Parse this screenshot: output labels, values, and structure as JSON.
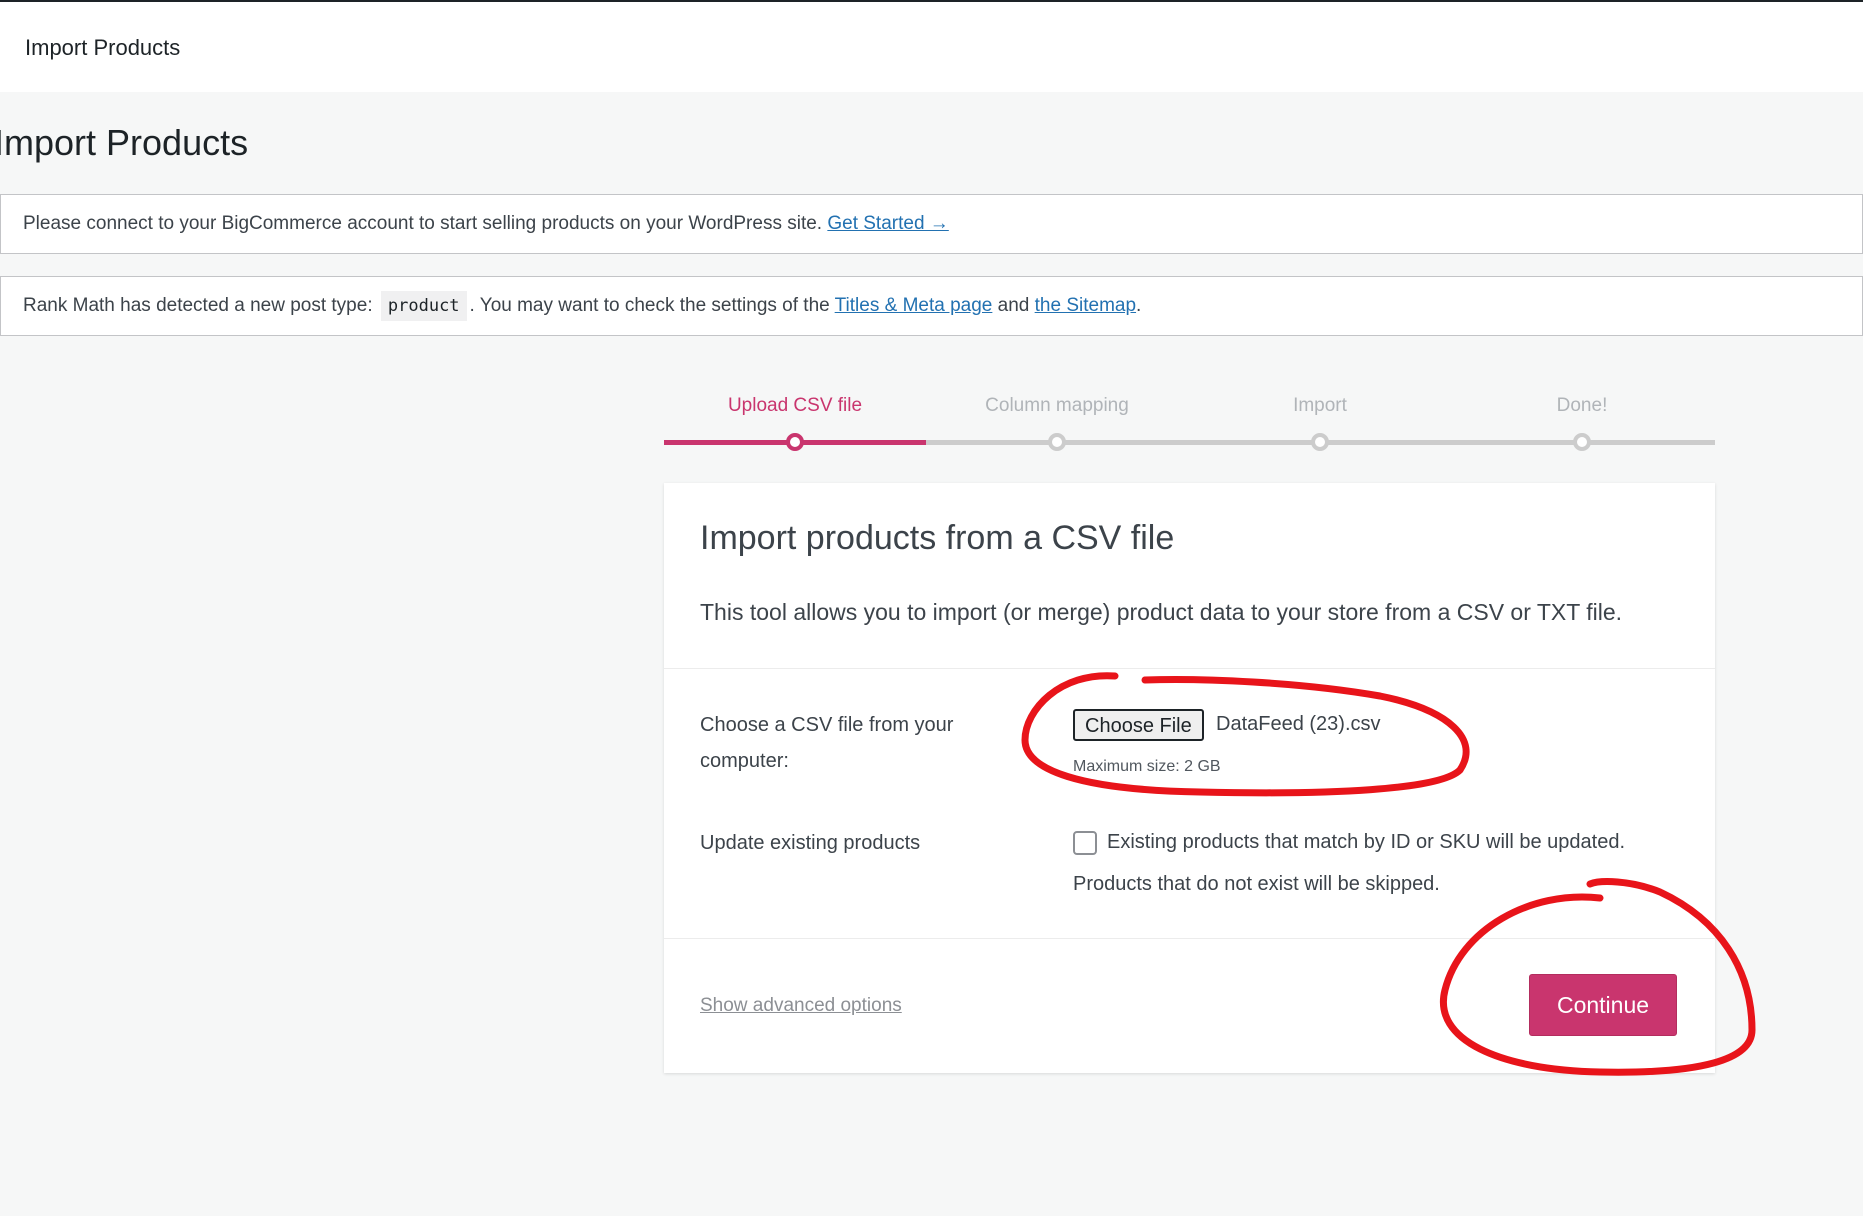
{
  "topbar": {
    "title": "Import Products"
  },
  "page": {
    "title": "Import Products"
  },
  "notices": {
    "bigcommerce": {
      "text": "Please connect to your BigCommerce account to start selling products on your WordPress site.",
      "link": "Get Started →"
    },
    "rankmath": {
      "text_before": "Rank Math has detected a new post type:",
      "code": "product",
      "text_middle": ". You may want to check the settings of the",
      "link_titles": "Titles & Meta page",
      "text_and": "and",
      "link_sitemap": "the Sitemap",
      "text_end": "."
    }
  },
  "steps": [
    {
      "label": "Upload CSV file",
      "active": true
    },
    {
      "label": "Column mapping",
      "active": false
    },
    {
      "label": "Import",
      "active": false
    },
    {
      "label": "Done!",
      "active": false
    }
  ],
  "card": {
    "title": "Import products from a CSV file",
    "description": "This tool allows you to import (or merge) product data to your store from a CSV or TXT file.",
    "file_label_line1": "Choose a CSV file from your",
    "file_label_line2": "computer:",
    "file_button": "Choose File",
    "file_name": "DataFeed (23).csv",
    "max_size": "Maximum size: 2 GB",
    "update_label": "Update existing products",
    "update_desc_line1": "Existing products that match by ID or SKU will be updated.",
    "update_desc_line2": "Products that do not exist will be skipped.",
    "advanced_link": "Show advanced options",
    "continue_button": "Continue"
  },
  "colors": {
    "accent": "#c9356e",
    "link": "#2271b1",
    "annotation": "#e8141a"
  }
}
